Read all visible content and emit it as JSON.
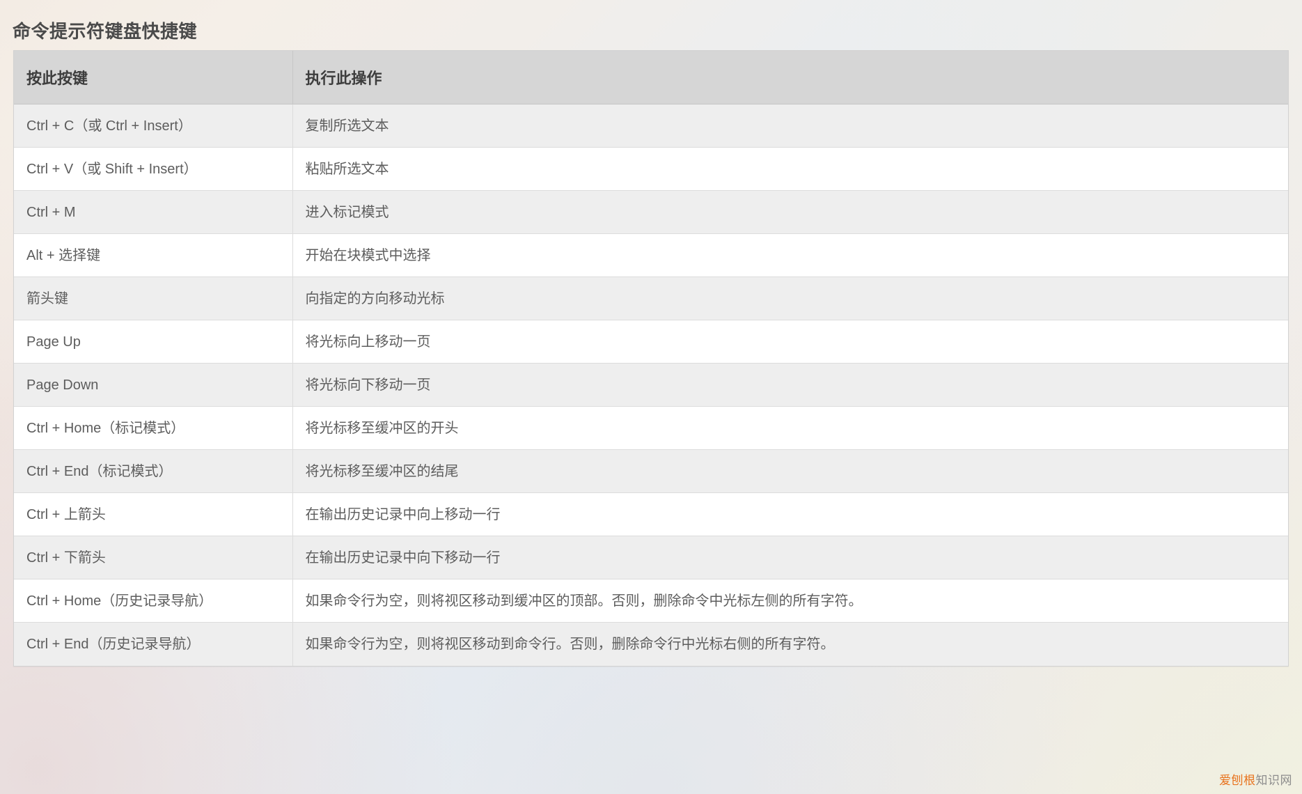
{
  "page": {
    "title": "命令提示符键盘快捷键"
  },
  "table": {
    "headers": [
      "按此按键",
      "执行此操作"
    ],
    "rows": [
      {
        "key": "Ctrl + C（或 Ctrl + Insert）",
        "action": "复制所选文本"
      },
      {
        "key": "Ctrl + V（或 Shift + Insert）",
        "action": "粘贴所选文本"
      },
      {
        "key": "Ctrl + M",
        "action": "进入标记模式"
      },
      {
        "key": "Alt + 选择键",
        "action": "开始在块模式中选择"
      },
      {
        "key": "箭头键",
        "action": "向指定的方向移动光标"
      },
      {
        "key": "Page Up",
        "action": "将光标向上移动一页"
      },
      {
        "key": "Page Down",
        "action": "将光标向下移动一页"
      },
      {
        "key": "Ctrl + Home（标记模式）",
        "action": "将光标移至缓冲区的开头"
      },
      {
        "key": "Ctrl + End（标记模式）",
        "action": "将光标移至缓冲区的结尾"
      },
      {
        "key": "Ctrl + 上箭头",
        "action": "在输出历史记录中向上移动一行"
      },
      {
        "key": "Ctrl + 下箭头",
        "action": "在输出历史记录中向下移动一行"
      },
      {
        "key": "Ctrl + Home（历史记录导航）",
        "action": "如果命令行为空，则将视区移动到缓冲区的顶部。否则，删除命令中光标左侧的所有字符。"
      },
      {
        "key": "Ctrl + End（历史记录导航）",
        "action": "如果命令行为空，则将视区移动到命令行。否则，删除命令行中光标右侧的所有字符。"
      }
    ]
  },
  "watermark": {
    "accent_text": "爱刨根",
    "rest_text": "知识网",
    "accent_color": "#e8731e",
    "rest_color": "#8d8d8d"
  },
  "colors": {
    "header_bg": "#d6d6d6",
    "row_odd_bg": "#eeeeee",
    "row_even_bg": "#ffffff",
    "border": "#dcdcdc",
    "text": "#5d5d5d",
    "title_text": "#4a4a4a"
  }
}
